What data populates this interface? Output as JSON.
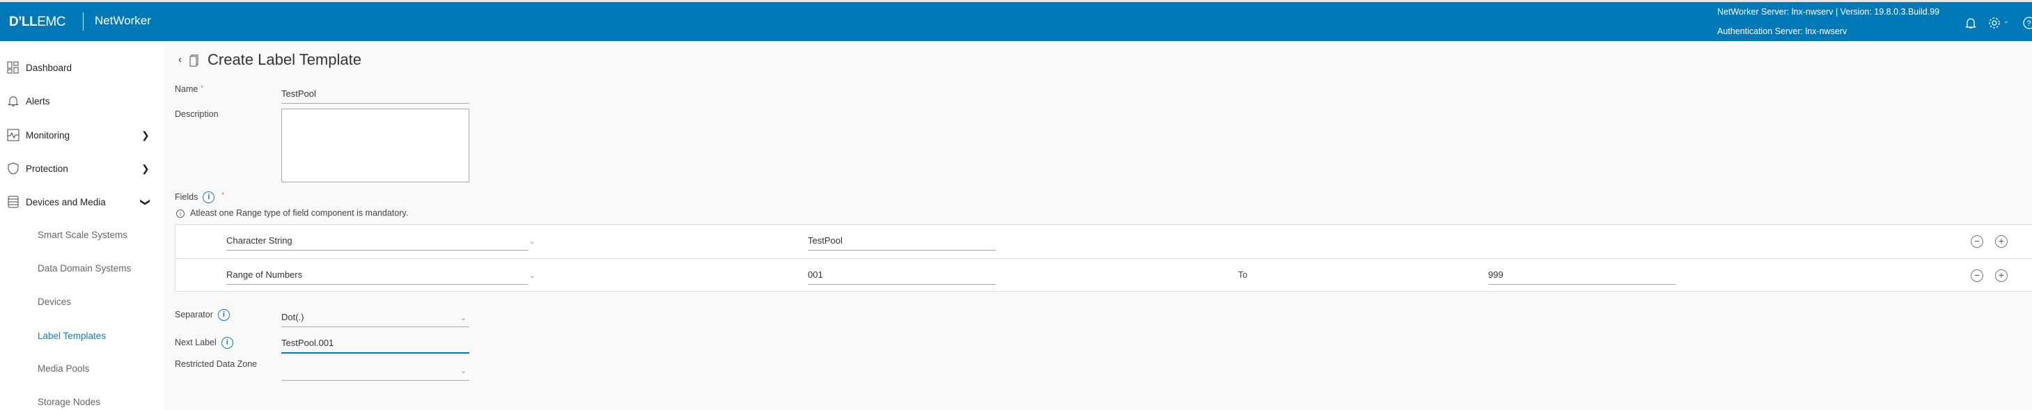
{
  "header": {
    "logo": "DELL EMC",
    "logo_brand": "D&#x2019;LL",
    "product": "NetWorker",
    "server_info": "NetWorker Server: lnx-nwserv | Version: 19.8.0.3.Build.99",
    "auth_server": "Authentication Server: lnx-nwserv",
    "icons": [
      "bell-icon",
      "gear-icon",
      "help-icon"
    ]
  },
  "sidebar": {
    "items": [
      {
        "label": "Dashboard"
      },
      {
        "label": "Alerts"
      },
      {
        "label": "Monitoring"
      },
      {
        "label": "Protection"
      },
      {
        "label": "Devices and Media"
      }
    ],
    "subitems": [
      {
        "label": "Smart Scale Systems"
      },
      {
        "label": "Data Domain Systems"
      },
      {
        "label": "Devices"
      },
      {
        "label": "Label Templates"
      },
      {
        "label": "Media Pools"
      },
      {
        "label": "Storage Nodes"
      }
    ],
    "active": "Label Templates"
  },
  "page": {
    "title": "Create Label Template"
  },
  "form": {
    "name_label": "Name",
    "name_value": "TestPool",
    "description_label": "Description",
    "description_value": "",
    "fields_label": "Fields",
    "fields_note": "Atleast one Range type of field component is mandatory.",
    "fields": [
      {
        "type": "Character String",
        "value": "TestPool"
      },
      {
        "type": "Range of Numbers",
        "from": "001",
        "to_label": "To",
        "to": "999"
      }
    ],
    "separator_label": "Separator",
    "separator_value": "Dot(.)",
    "next_label_label": "Next Label",
    "next_label_value": "TestPool.001",
    "rdz_label": "Restricted Data Zone",
    "rdz_value": "",
    "required_mark": "*"
  },
  "colors": {
    "header": "#0079b8",
    "accent": "#1a7bbd"
  }
}
